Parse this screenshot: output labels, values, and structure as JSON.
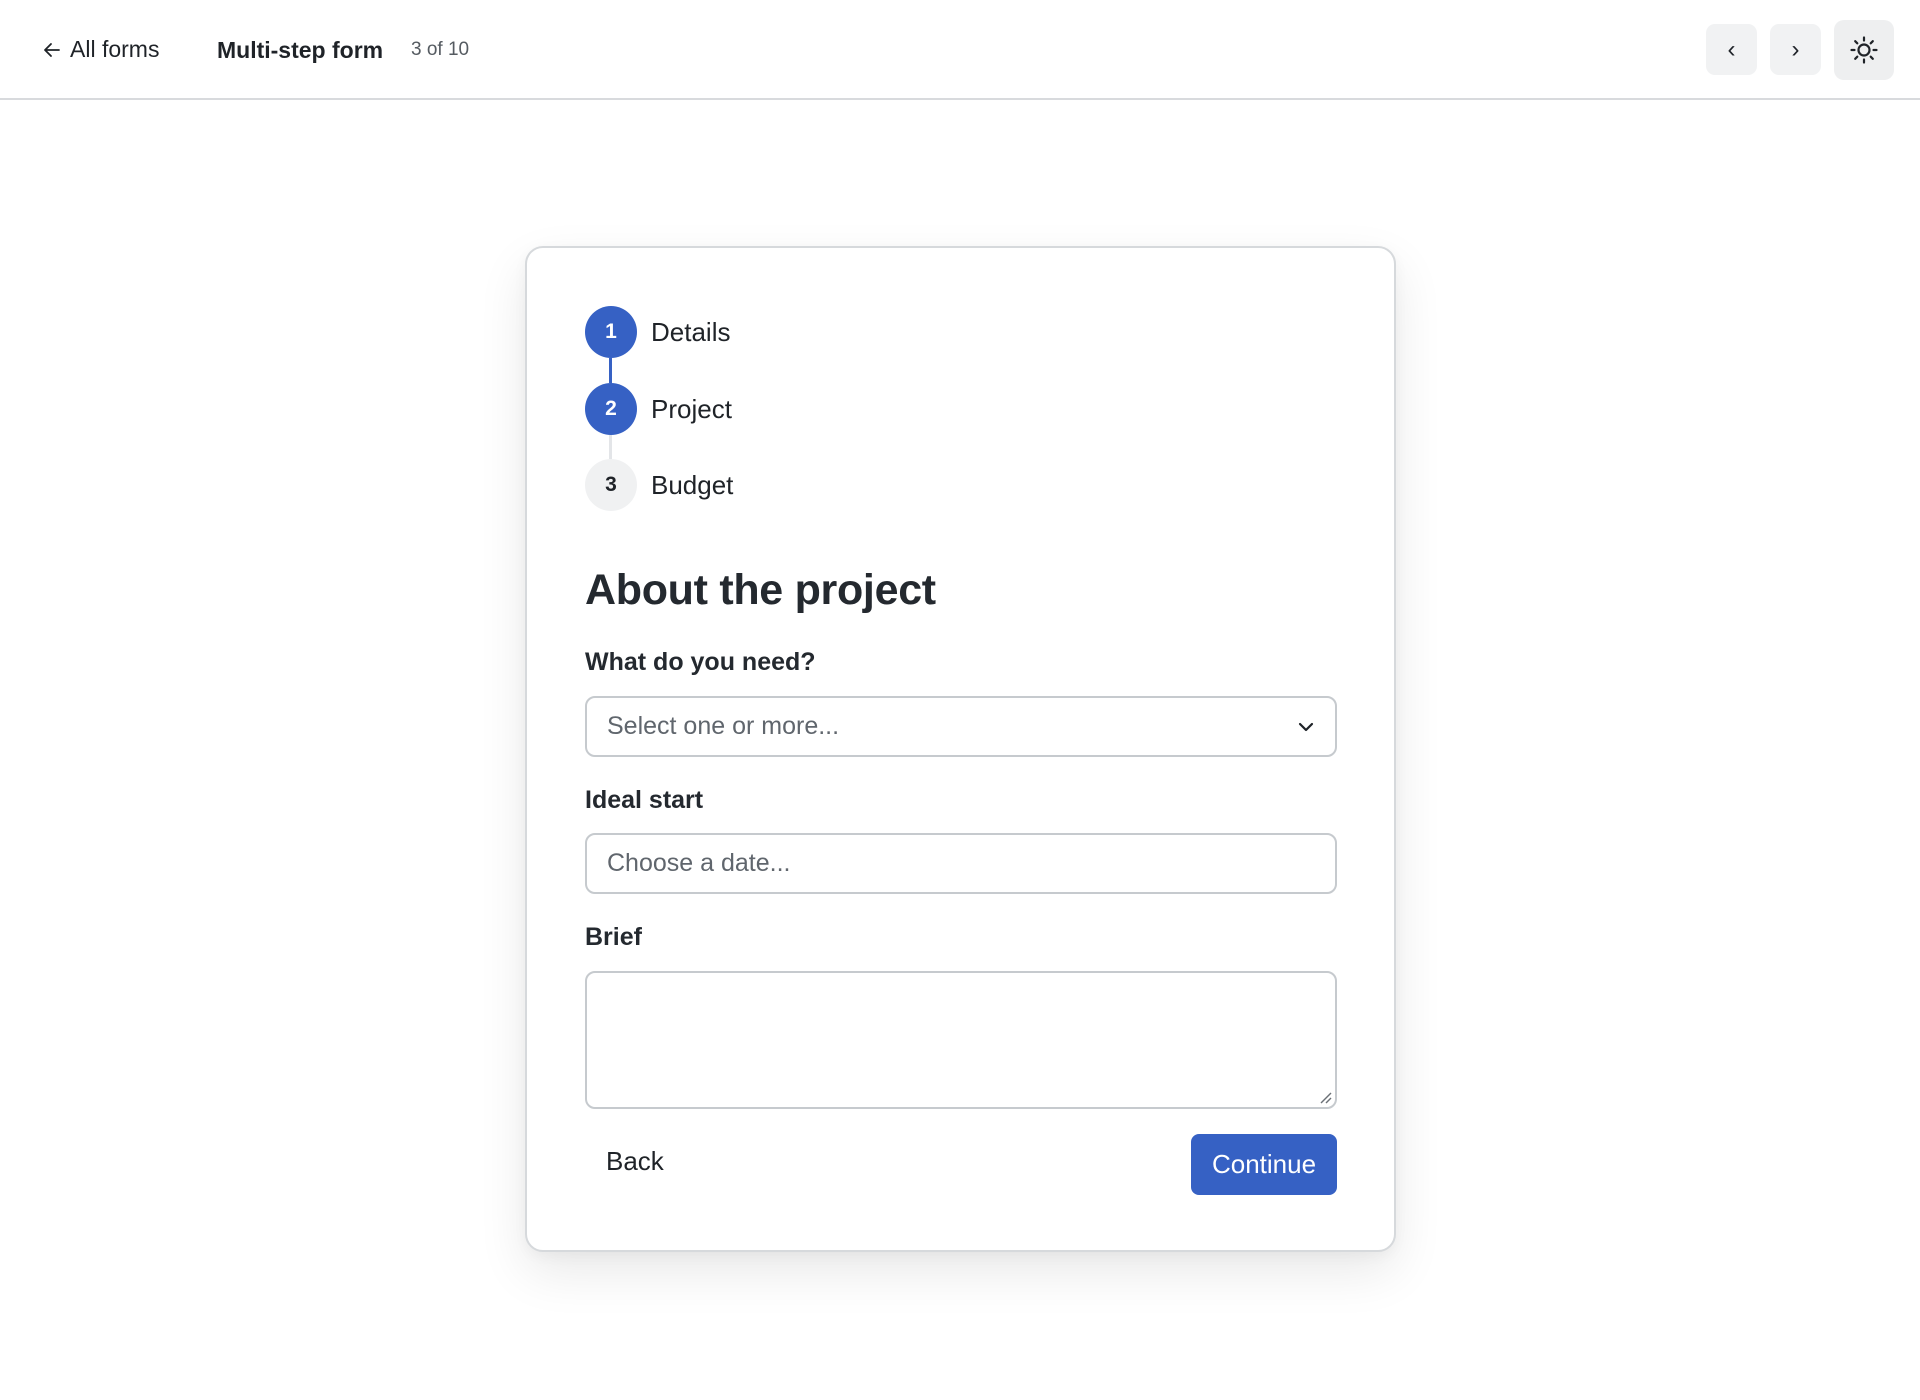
{
  "header": {
    "back_label": "All forms",
    "title": "Multi-step form",
    "counter": "3 of 10",
    "prev_symbol": "‹",
    "next_symbol": "›"
  },
  "stepper": {
    "steps": [
      {
        "number": "1",
        "label": "Details",
        "state": "complete"
      },
      {
        "number": "2",
        "label": "Project",
        "state": "current"
      },
      {
        "number": "3",
        "label": "Budget",
        "state": "upcoming"
      }
    ]
  },
  "form": {
    "title": "About the project",
    "need": {
      "label": "What do you need?",
      "placeholder": "Select one or more..."
    },
    "start": {
      "label": "Ideal start",
      "placeholder": "Choose a date..."
    },
    "brief": {
      "label": "Brief",
      "value": ""
    },
    "back_label": "Back",
    "continue_label": "Continue"
  },
  "colors": {
    "accent": "#3661c4",
    "step_pending": "#f0f1f2",
    "border": "#c6cace"
  },
  "icons": {
    "back": "arrow-left-icon",
    "theme": "sun-icon",
    "select": "chevron-down-icon"
  }
}
